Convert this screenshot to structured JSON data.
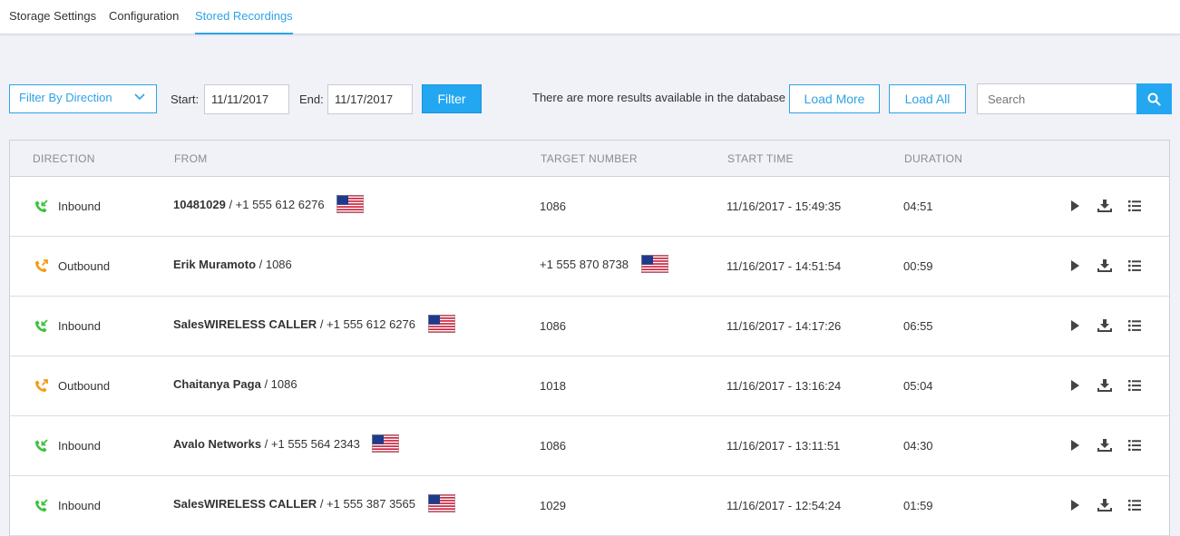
{
  "tabs": [
    {
      "label": "Storage Settings",
      "active": false
    },
    {
      "label": "Configuration",
      "active": false
    },
    {
      "label": "Stored Recordings",
      "active": true
    }
  ],
  "toolbar": {
    "direction_filter": "Filter By Direction",
    "start_label": "Start:",
    "start_value": "11/11/2017",
    "end_label": "End:",
    "end_value": "11/17/2017",
    "filter_button": "Filter",
    "more_results_text": "There are more results available in the database",
    "load_more_button": "Load More",
    "load_all_button": "Load All",
    "search_placeholder": "Search"
  },
  "table": {
    "headers": {
      "direction": "DIRECTION",
      "from": "FROM",
      "target": "TARGET NUMBER",
      "start_time": "START TIME",
      "duration": "DURATION"
    },
    "rows": [
      {
        "direction": "Inbound",
        "from_name": "10481029",
        "from_rest": " / +1 555 612 6276",
        "from_flag": true,
        "target": "1086",
        "target_flag": false,
        "start_time": "11/16/2017 - 15:49:35",
        "duration": "04:51"
      },
      {
        "direction": "Outbound",
        "from_name": "Erik Muramoto",
        "from_rest": " / 1086",
        "from_flag": false,
        "target": "+1 555 870 8738",
        "target_flag": true,
        "start_time": "11/16/2017 - 14:51:54",
        "duration": "00:59"
      },
      {
        "direction": "Inbound",
        "from_name": "SalesWIRELESS CALLER",
        "from_rest": " / +1 555 612 6276",
        "from_flag": true,
        "target": "1086",
        "target_flag": false,
        "start_time": "11/16/2017 - 14:17:26",
        "duration": "06:55"
      },
      {
        "direction": "Outbound",
        "from_name": "Chaitanya Paga",
        "from_rest": " / 1086",
        "from_flag": false,
        "target": "1018",
        "target_flag": false,
        "start_time": "11/16/2017 - 13:16:24",
        "duration": "05:04"
      },
      {
        "direction": "Inbound",
        "from_name": "Avalo Networks",
        "from_rest": " / +1 555 564 2343",
        "from_flag": true,
        "target": "1086",
        "target_flag": false,
        "start_time": "11/16/2017 - 13:11:51",
        "duration": "04:30"
      },
      {
        "direction": "Inbound",
        "from_name": "SalesWIRELESS CALLER",
        "from_rest": " / +1 555 387 3565",
        "from_flag": true,
        "target": "1029",
        "target_flag": false,
        "start_time": "11/16/2017 - 12:54:24",
        "duration": "01:59"
      }
    ]
  },
  "colors": {
    "accent": "#22a7f0",
    "inbound_icon": "#3cc13b",
    "outbound_icon": "#f39c12",
    "action_icon": "#444444"
  },
  "icons": {
    "inbound": "phone-inbound-icon",
    "outbound": "phone-outbound-icon",
    "play": "play-icon",
    "download": "download-icon",
    "details": "list-icon",
    "search": "search-icon",
    "dropdown": "chevron-down-icon",
    "flag": "us-flag-icon"
  }
}
